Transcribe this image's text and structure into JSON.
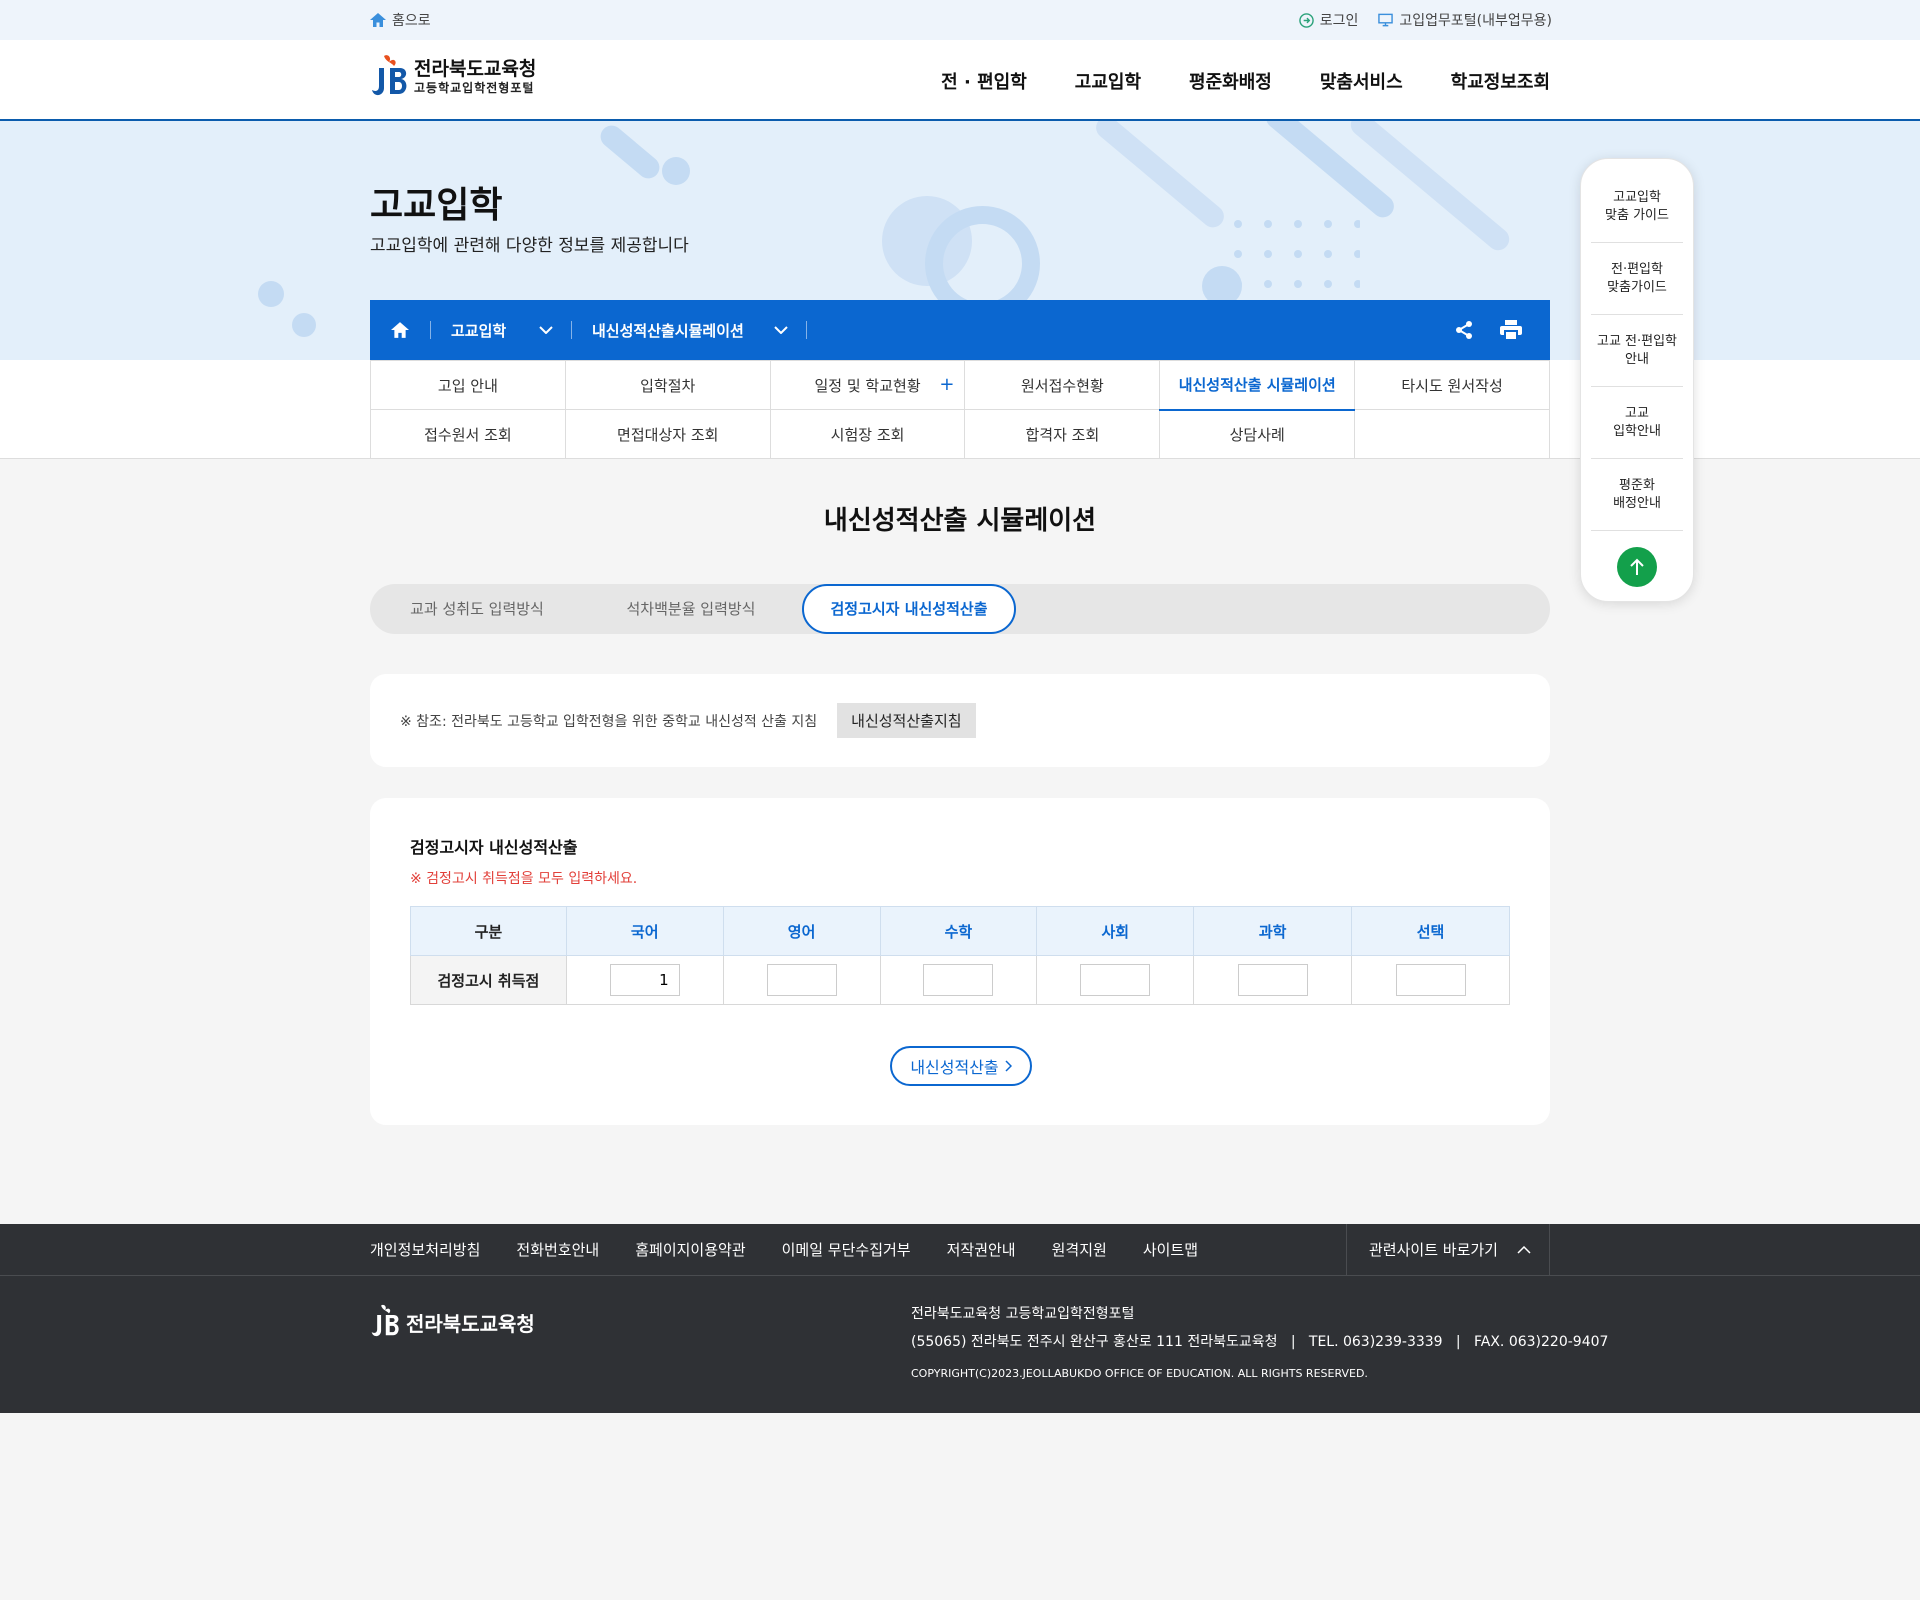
{
  "topbar": {
    "home_label": "홈으로",
    "login_label": "로그인",
    "portal_label": "고입업무포털(내부업무용)"
  },
  "header": {
    "logo_title": "전라북도교육청",
    "logo_subtitle": "고등학교입학전형포털",
    "nav": [
      "전 · 편입학",
      "고교입학",
      "평준화배정",
      "맞춤서비스",
      "학교정보조회"
    ]
  },
  "visual": {
    "title": "고교입학",
    "subtitle": "고교입학에 관련해 다양한 정보를 제공합니다"
  },
  "location": {
    "depth1": "고교입학",
    "depth2": "내신성적산출시뮬레이션"
  },
  "subnav": {
    "row1": [
      "고입 안내",
      "입학절차",
      "일정 및 학교현황",
      "원서접수현황",
      "내신성적산출 시뮬레이션",
      "타시도 원서작성"
    ],
    "row2": [
      "접수원서 조회",
      "면접대상자 조회",
      "시험장 조회",
      "합격자 조회",
      "상담사례",
      ""
    ],
    "plus": "+"
  },
  "quick_menu": [
    {
      "line1": "고교입학",
      "line2": "맞춤 가이드"
    },
    {
      "line1": "전·편입학",
      "line2": "맞춤가이드"
    },
    {
      "line1": "고교 전·편입학",
      "line2": "안내"
    },
    {
      "line1": "고교",
      "line2": "입학안내"
    },
    {
      "line1": "평준화",
      "line2": "배정안내"
    }
  ],
  "page": {
    "title": "내신성적산출 시뮬레이션",
    "tabs": [
      "교과 성취도 입력방식",
      "석차백분율 입력방식",
      "검정고시자 내신성적산출"
    ]
  },
  "reference": {
    "text": "※ 참조: 전라북도 고등학교 입학전형을 위한 중학교 내신성적 산출 지침",
    "button": "내신성적산출지침"
  },
  "calc": {
    "heading": "검정고시자 내신성적산출",
    "note": "※ 검정고시 취득점을 모두 입력하세요.",
    "columns": [
      "구분",
      "국어",
      "영어",
      "수학",
      "사회",
      "과학",
      "선택"
    ],
    "row_label": "검정고시 취득점",
    "values": [
      "1",
      "",
      "",
      "",
      "",
      ""
    ],
    "button": "내신성적산출"
  },
  "footer": {
    "links": [
      "개인정보처리방침",
      "전화번호안내",
      "홈페이지이용약관",
      "이메일 무단수집거부",
      "저작권안내",
      "원격지원",
      "사이트맵"
    ],
    "related": "관련사이트 바로가기",
    "logo_text": "전라북도교육청",
    "org": "전라북도교육청 고등학교입학전형포털",
    "address": "(55065) 전라북도 전주시 완산구 홍산로 111 전라북도교육청   |   TEL. 063)239-3339   |   FAX. 063)220-9407",
    "copyright": "COPYRIGHT(C)2023.JEOLLABUKDO OFFICE OF EDUCATION. ALL RIGHTS RESERVED."
  },
  "colors": {
    "primary": "#0b67d0",
    "alert": "#e2403a",
    "top_button": "#13a04b",
    "footer_bg": "#2f3135"
  }
}
